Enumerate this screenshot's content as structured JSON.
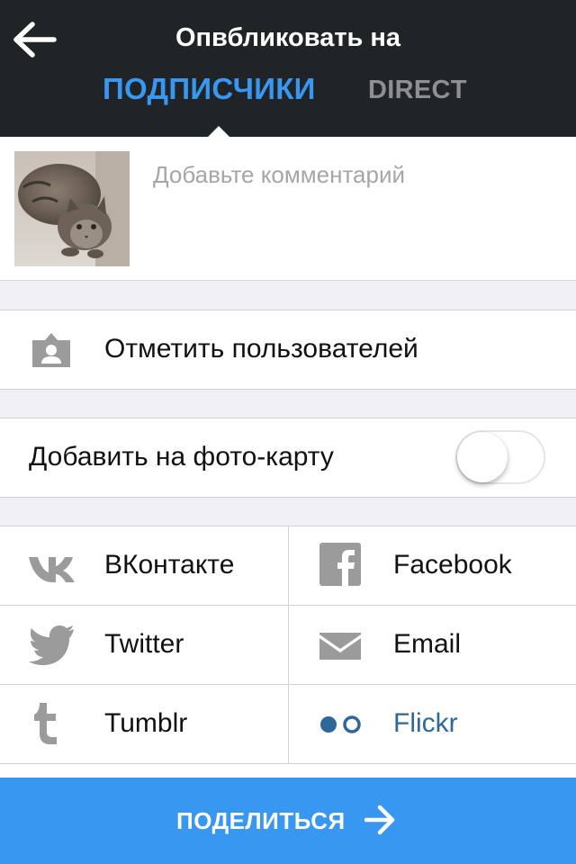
{
  "header": {
    "title": "Опвбликовать на",
    "tabs": [
      {
        "label": "ПОДПИСЧИКИ",
        "active": true
      },
      {
        "label": "DIRECT",
        "active": false
      }
    ],
    "back_icon": "arrow-left-icon"
  },
  "composer": {
    "thumbnail": "cat-photo-thumbnail",
    "comment_placeholder": "Добавьте комментарий",
    "comment_value": ""
  },
  "tag_people": {
    "label": "Отметить пользователей",
    "icon": "person-tag-icon"
  },
  "photo_map": {
    "label": "Добавить на фото-карту",
    "enabled": false
  },
  "share_targets": [
    {
      "label": "ВКонтакте",
      "icon": "vk-icon",
      "selected": false
    },
    {
      "label": "Facebook",
      "icon": "facebook-icon",
      "selected": false
    },
    {
      "label": "Twitter",
      "icon": "twitter-icon",
      "selected": false
    },
    {
      "label": "Email",
      "icon": "email-icon",
      "selected": false
    },
    {
      "label": "Tumblr",
      "icon": "tumblr-icon",
      "selected": false
    },
    {
      "label": "Flickr",
      "icon": "flickr-icon",
      "selected": true
    }
  ],
  "share_button": {
    "label": "ПОДЕЛИТЬСЯ",
    "icon": "arrow-right-icon"
  },
  "colors": {
    "header_bg": "#212427",
    "accent": "#3897f0",
    "inactive_tab": "#8e8e93",
    "icon_gray": "#a0a0a0",
    "flickr_blue": "#2f6798"
  }
}
